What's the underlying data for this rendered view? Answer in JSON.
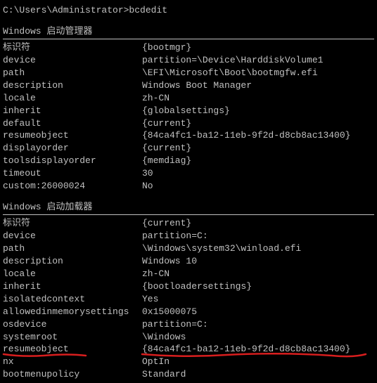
{
  "prompt": "C:\\Users\\Administrator>bcdedit",
  "section1_title": "Windows 启动管理器",
  "section2_title": "Windows 启动加载器",
  "mgr": {
    "k0": "标识符",
    "v0": "{bootmgr}",
    "k1": "device",
    "v1": "partition=\\Device\\HarddiskVolume1",
    "k2": "path",
    "v2": "\\EFI\\Microsoft\\Boot\\bootmgfw.efi",
    "k3": "description",
    "v3": "Windows Boot Manager",
    "k4": "locale",
    "v4": "zh-CN",
    "k5": "inherit",
    "v5": "{globalsettings}",
    "k6": "default",
    "v6": "{current}",
    "k7": "resumeobject",
    "v7": "{84ca4fc1-ba12-11eb-9f2d-d8cb8ac13400}",
    "k8": "displayorder",
    "v8": "{current}",
    "k9": "toolsdisplayorder",
    "v9": "{memdiag}",
    "k10": "timeout",
    "v10": "30",
    "k11": "custom:26000024",
    "v11": "No"
  },
  "ldr": {
    "k0": "标识符",
    "v0": "{current}",
    "k1": "device",
    "v1": "partition=C:",
    "k2": "path",
    "v2": "\\Windows\\system32\\winload.efi",
    "k3": "description",
    "v3": "Windows 10",
    "k4": "locale",
    "v4": "zh-CN",
    "k5": "inherit",
    "v5": "{bootloadersettings}",
    "k6": "isolatedcontext",
    "v6": "Yes",
    "k7": "allowedinmemorysettings",
    "v7": "0x15000075",
    "k8": "osdevice",
    "v8": "partition=C:",
    "k9": "systemroot",
    "v9": "\\Windows",
    "k10": "resumeobject",
    "v10": "{84ca4fc1-ba12-11eb-9f2d-d8cb8ac13400}",
    "k11": "nx",
    "v11": "OptIn",
    "k12": "bootmenupolicy",
    "v12": "Standard"
  }
}
